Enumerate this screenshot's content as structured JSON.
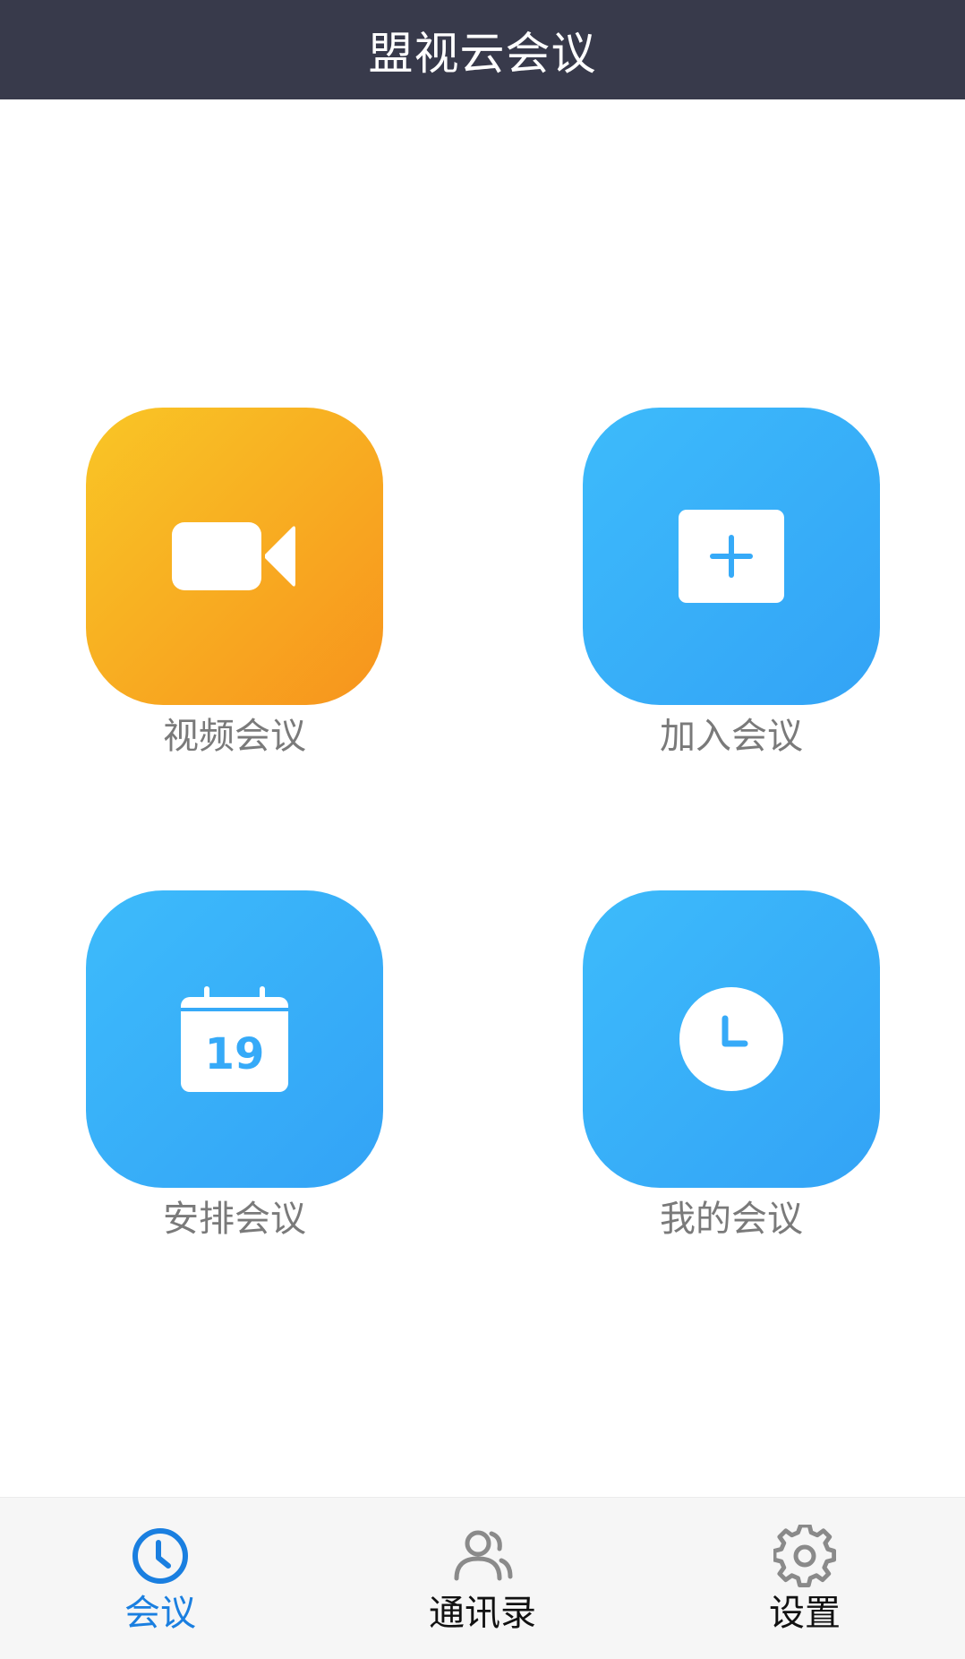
{
  "header": {
    "title": "盟视云会议"
  },
  "tiles": [
    {
      "label": "视频会议",
      "icon": "video-camera-icon",
      "color": "orange"
    },
    {
      "label": "加入会议",
      "icon": "add-square-icon",
      "color": "blue"
    },
    {
      "label": "安排会议",
      "icon": "calendar-icon",
      "color": "blue",
      "icon_text": "19"
    },
    {
      "label": "我的会议",
      "icon": "clock-icon",
      "color": "blue"
    }
  ],
  "tabbar": {
    "items": [
      {
        "label": "会议",
        "icon": "clock-icon",
        "active": true
      },
      {
        "label": "通讯录",
        "icon": "contacts-icon",
        "active": false
      },
      {
        "label": "设置",
        "icon": "gear-icon",
        "active": false
      }
    ]
  },
  "colors": {
    "header_bg": "#383a4b",
    "tile_orange_start": "#f9c626",
    "tile_orange_end": "#f7941d",
    "tile_blue": "#36aaf8",
    "tab_active": "#1a7fe0",
    "tab_inactive_text": "#111111",
    "tab_inactive_icon": "#8a8a8a",
    "tile_label": "#7a7a7a"
  }
}
